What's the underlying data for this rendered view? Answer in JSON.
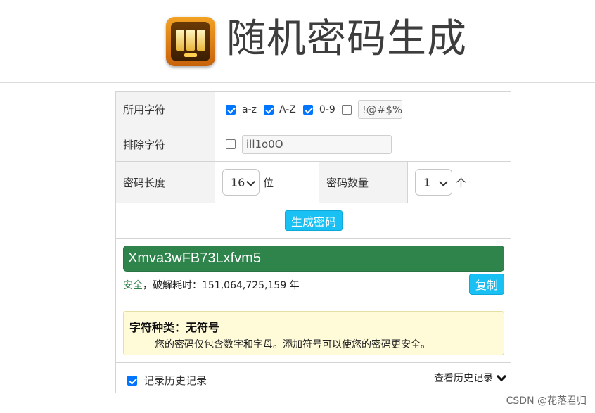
{
  "header": {
    "title": "随机密码生成",
    "logo_icon": "slot-machine-icon"
  },
  "settings": {
    "charset": {
      "label": "所用字符",
      "options": [
        {
          "label": "a-z",
          "checked": true
        },
        {
          "label": "A-Z",
          "checked": true
        },
        {
          "label": "0-9",
          "checked": true
        },
        {
          "label": "",
          "checked": false
        }
      ],
      "symbols_value": "!@#$%"
    },
    "exclude": {
      "label": "排除字符",
      "checked": false,
      "value": "ill1o0O"
    },
    "length": {
      "label": "密码长度",
      "value": "16",
      "unit": "位"
    },
    "count": {
      "label": "密码数量",
      "value": "1",
      "unit": "个"
    }
  },
  "generate_button": "生成密码",
  "result": {
    "password": "Xmva3wFB73Lxfvm5",
    "strength_word": "安全",
    "crack_text": "，破解耗时：151,064,725,159 年",
    "copy_button": "复制"
  },
  "notice": {
    "title": "字符种类：无符号",
    "body": "您的密码仅包含数字和字母。添加符号可以使您的密码更安全。"
  },
  "footer": {
    "record_history_label": "记录历史记录",
    "record_history_checked": true,
    "view_history_label": "查看历史记录"
  },
  "watermark": "CSDN @花落君归",
  "colors": {
    "accent": "#18c0f4",
    "result_bg": "#2e844b",
    "notice_bg": "#fffbd9"
  }
}
